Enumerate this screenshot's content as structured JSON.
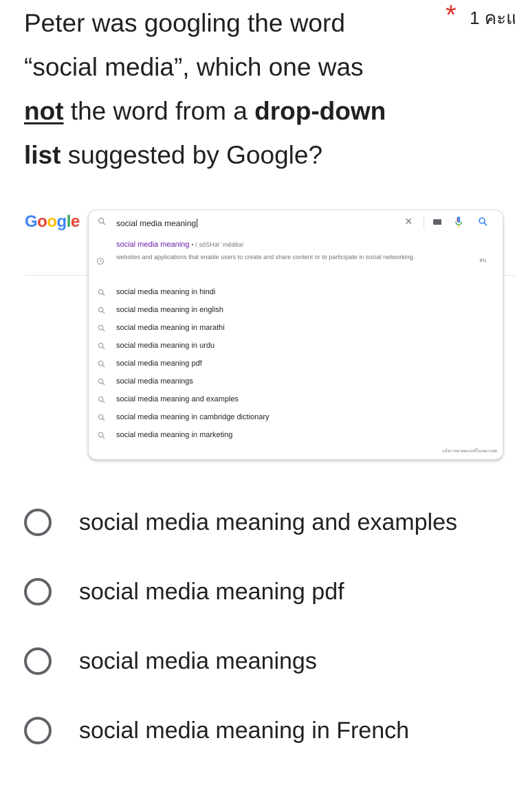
{
  "question": {
    "line1": "Peter was googling the word",
    "line2": "“social media”, which one was",
    "line3_underlined": "not",
    "line3_text": " the word from a ",
    "line3_bold": "drop-down",
    "line4_bold": "list",
    "line4_text": " suggested by Google?",
    "required_mark": "*",
    "points": "1 คะแ"
  },
  "google_screenshot": {
    "logo": {
      "letters": [
        "G",
        "o",
        "o",
        "g",
        "l",
        "e"
      ],
      "colors": [
        "#4285F4",
        "#EA4335",
        "#FBBC05",
        "#4285F4",
        "#34A853",
        "#EA4335"
      ]
    },
    "query": "social media meaning",
    "definition": {
      "title": "social media meaning",
      "phonetic": "• /ˌsōSHəl ˈmēdēə/",
      "text": "websites and applications that enable users to create and share content or to participate in social networking.",
      "remove_label": "ลบ"
    },
    "suggestions": [
      "social media meaning in hindi",
      "social media meaning in english",
      "social media meaning in marathi",
      "social media meaning in urdu",
      "social media meaning pdf",
      "social media meanings",
      "social media meaning and examples",
      "social media meaning in cambridge dictionary",
      "social media meaning in marketing"
    ],
    "report_text": "แจ้งการคาดคะเนที่ไม่เหมาะสม"
  },
  "options": [
    {
      "label": "social media meaning and examples",
      "selected": false
    },
    {
      "label": "social media meaning pdf",
      "selected": false
    },
    {
      "label": "social media meanings",
      "selected": false
    },
    {
      "label": "social media meaning in French",
      "selected": false
    }
  ],
  "colors": {
    "required": "#d93025",
    "radio_border": "#5f6368",
    "mic_blue": "#4285F4",
    "mic_red": "#EA4335",
    "definition_title": "#681da8"
  }
}
